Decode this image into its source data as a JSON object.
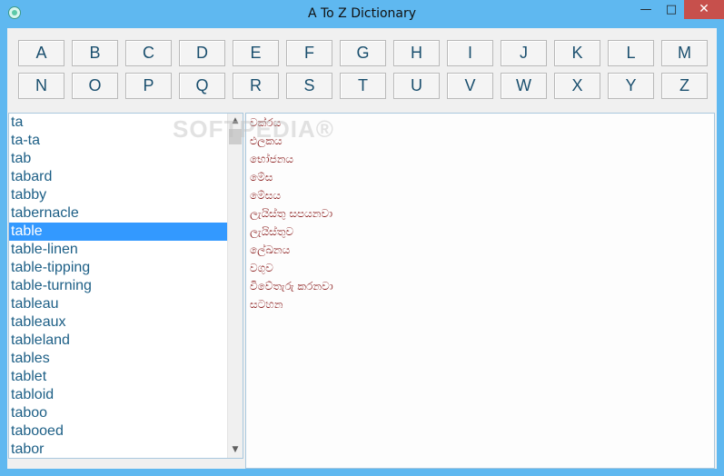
{
  "window": {
    "title": "A To Z Dictionary",
    "minimize_glyph": "—",
    "maximize_glyph": "□",
    "close_glyph": "✕"
  },
  "letters": [
    "A",
    "B",
    "C",
    "D",
    "E",
    "F",
    "G",
    "H",
    "I",
    "J",
    "K",
    "L",
    "M",
    "N",
    "O",
    "P",
    "Q",
    "R",
    "S",
    "T",
    "U",
    "V",
    "W",
    "X",
    "Y",
    "Z"
  ],
  "word_list": {
    "selected_index": 6,
    "items": [
      "ta",
      "ta-ta",
      "tab",
      "tabard",
      "tabby",
      "tabernacle",
      "table",
      "table-linen",
      "table-tipping",
      "table-turning",
      "tableau",
      "tableaux",
      "tableland",
      "tables",
      "tablet",
      "tabloid",
      "taboo",
      "tabooed",
      "tabor"
    ]
  },
  "meanings": [
    "වක්රය",
    "එලකය",
    "භෝජනය",
    "මේස",
    "මේසය",
    "ලැයිස්තු සපයනවා",
    "ලැයිස්තුව",
    "ලේඛනය",
    "වගුව",
    "විවේතැරු කරනවා",
    "සටහන"
  ],
  "watermark": "SOFTPEDIA®",
  "colors": {
    "frame": "#5fb8f0",
    "selection": "#3399ff",
    "word_text": "#1d5f86",
    "meaning_text": "#8a1c1c",
    "close_button": "#c7504c"
  }
}
